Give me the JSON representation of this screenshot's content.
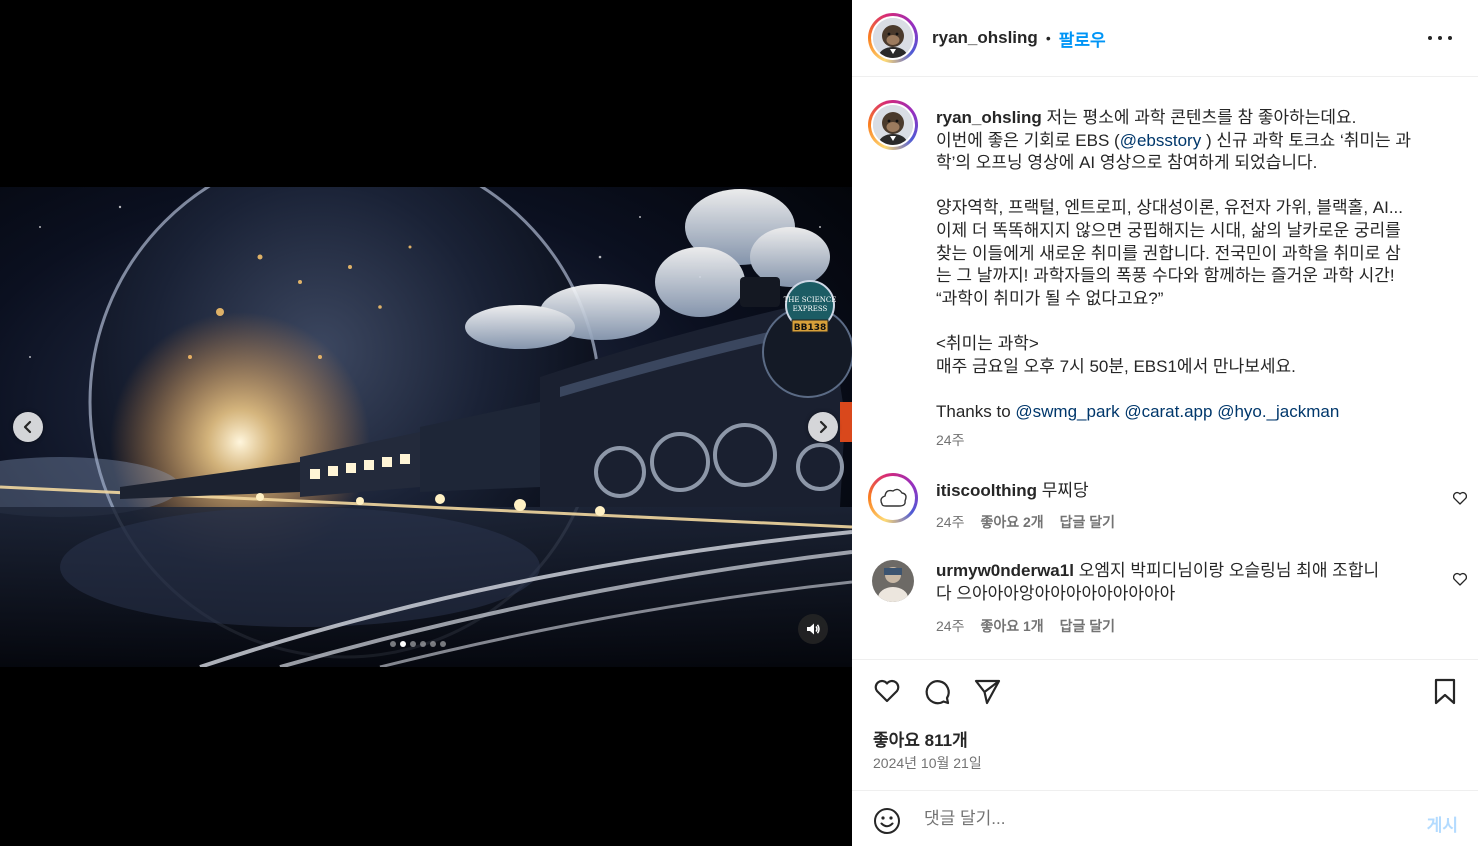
{
  "header": {
    "username": "ryan_ohsling",
    "separator": "•",
    "follow_label": "팔로우",
    "more_icon": "more-horizontal-icon"
  },
  "media": {
    "prev_icon": "chevron-left-icon",
    "next_icon": "chevron-right-icon",
    "audio_icon": "speaker-icon",
    "slide_count": 6,
    "active_slide": 1,
    "train_sign": {
      "line1": "THE SCIENCE",
      "line2": "EXPRESS",
      "number": "BB138"
    }
  },
  "caption": {
    "username": "ryan_ohsling",
    "line1": "저는 평소에 과학 콘텐츠를 참 좋아하는데요.",
    "line2_pre": "이번에 좋은 기회로 EBS (",
    "line2_mention": "@ebsstory",
    "line2_post": " ) 신규 과학 토크쇼 ‘취미는 과",
    "line3": "학’의 오프닝 영상에 AI 영상으로 참여하게 되었습니다.",
    "para2_line1": "양자역학, 프랙털, 엔트로피, 상대성이론, 유전자 가위, 블랙홀, AI...",
    "para2_line2": "이제 더 똑똑해지지 않으면 궁핍해지는 시대, 삶의 날카로운 궁리를",
    "para2_line3": "찾는 이들에게 새로운 취미를 권합니다. 전국민이 과학을 취미로 삼",
    "para2_line4": "는 그 날까지! 과학자들의 폭풍 수다와 함께하는 즐거운 과학 시간!",
    "para2_line5": "“과학이 취미가 될 수 없다고요?”",
    "para3_line1": "<취미는 과학>",
    "para3_line2": "매주 금요일 오후 7시 50분, EBS1에서 만나보세요.",
    "thanks_label": "Thanks to",
    "thanks_mentions": [
      "@swmg_park",
      "@carat.app",
      "@hyo._jackman"
    ],
    "time": "24주"
  },
  "comments": [
    {
      "username": "itiscoolthing",
      "text": "무찌당",
      "time": "24주",
      "likes": "좋아요 2개",
      "reply": "답글 달기"
    },
    {
      "username": "urmyw0nderwa1l",
      "text_line1": "오엠지 박피디님이랑 오슬링님 최애 조합니",
      "text_line2": "다 으아아아앙아아아아아아아아아",
      "time": "24주",
      "likes": "좋아요 1개",
      "reply": "답글 달기"
    }
  ],
  "actions": {
    "like_icon": "heart-icon",
    "comment_icon": "comment-icon",
    "share_icon": "send-icon",
    "save_icon": "bookmark-icon",
    "likes_label": "좋아요 811개",
    "date": "2024년 10월 21일"
  },
  "add_comment": {
    "emoji_icon": "smiley-icon",
    "placeholder": "댓글 달기...",
    "post_label": "게시"
  },
  "colors": {
    "link": "#0095f6",
    "mention": "#00376b",
    "muted": "#737373",
    "post_disabled": "#b3dbff"
  }
}
